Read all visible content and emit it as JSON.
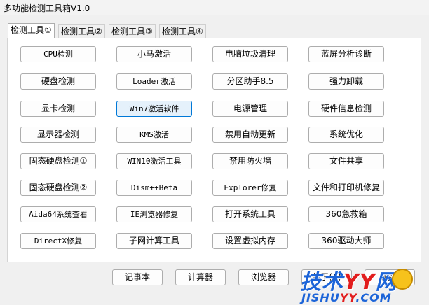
{
  "window": {
    "title": "多功能检测工具箱V1.0"
  },
  "tabs": [
    "检测工具①",
    "检测工具②",
    "检测工具③",
    "检测工具④"
  ],
  "grid": [
    [
      "CPU检测",
      "小马激活",
      "电脑垃圾清理",
      "蓝屏分析诊断"
    ],
    [
      "硬盘检测",
      "Loader激活",
      "分区助手8.5",
      "强力卸载"
    ],
    [
      "显卡检测",
      "Win7激活软件",
      "电源管理",
      "硬件信息检测"
    ],
    [
      "显示器检测",
      "KMS激活",
      "禁用自动更新",
      "系统优化"
    ],
    [
      "固态硬盘检测①",
      "WIN10激活工具",
      "禁用防火墙",
      "文件共享"
    ],
    [
      "固态硬盘检测②",
      "Dism++Beta",
      "Explorer修复",
      "文件和打印机修复"
    ],
    [
      "Aida64系统查看",
      "IE浏览器修复",
      "打开系统工具",
      "360急救箱"
    ],
    [
      "DirectX修复",
      "子网计算工具",
      "设置虚拟内存",
      "360驱动大师"
    ]
  ],
  "bottom_buttons": [
    "记事本",
    "计算器",
    "浏览器",
    "关于(A)",
    "退出"
  ],
  "watermark": {
    "main_a": "技术",
    "main_b": "YY",
    "main_c": "网",
    "sub_a": "JISHU",
    "sub_b": "YY",
    "sub_c": ".COM"
  },
  "colors": {
    "focus_border": "#0078d7",
    "focus_fill": "#e5f1fb",
    "watermark_blue": "#1c64d8",
    "watermark_red": "#e21d1d"
  }
}
